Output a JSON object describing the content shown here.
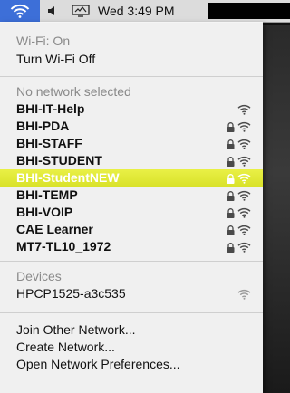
{
  "menubar": {
    "clock": "Wed 3:49 PM",
    "icons": [
      "wifi-icon",
      "volume-icon",
      "display-icon"
    ],
    "accent": "#3d6fd8"
  },
  "status": {
    "wifi_on": "Wi-Fi: On",
    "turn_off": "Turn Wi-Fi Off"
  },
  "networks": {
    "header": "No network selected",
    "items": [
      {
        "label": "BHI-IT-Help",
        "locked": false,
        "selected": false
      },
      {
        "label": "BHI-PDA",
        "locked": true,
        "selected": false
      },
      {
        "label": "BHI-STAFF",
        "locked": true,
        "selected": false
      },
      {
        "label": "BHI-STUDENT",
        "locked": true,
        "selected": false
      },
      {
        "label": "BHI-StudentNEW",
        "locked": true,
        "selected": true
      },
      {
        "label": "BHI-TEMP",
        "locked": true,
        "selected": false
      },
      {
        "label": "BHI-VOIP",
        "locked": true,
        "selected": false
      },
      {
        "label": "CAE Learner",
        "locked": true,
        "selected": false
      },
      {
        "label": "MT7-TL10_1972",
        "locked": true,
        "selected": false
      }
    ],
    "highlight_color": "#d9e22a"
  },
  "devices": {
    "header": "Devices",
    "items": [
      {
        "label": "HPCP1525-a3c535"
      }
    ]
  },
  "actions": {
    "join_other": "Join Other Network...",
    "create": "Create Network...",
    "open_prefs": "Open Network Preferences..."
  }
}
